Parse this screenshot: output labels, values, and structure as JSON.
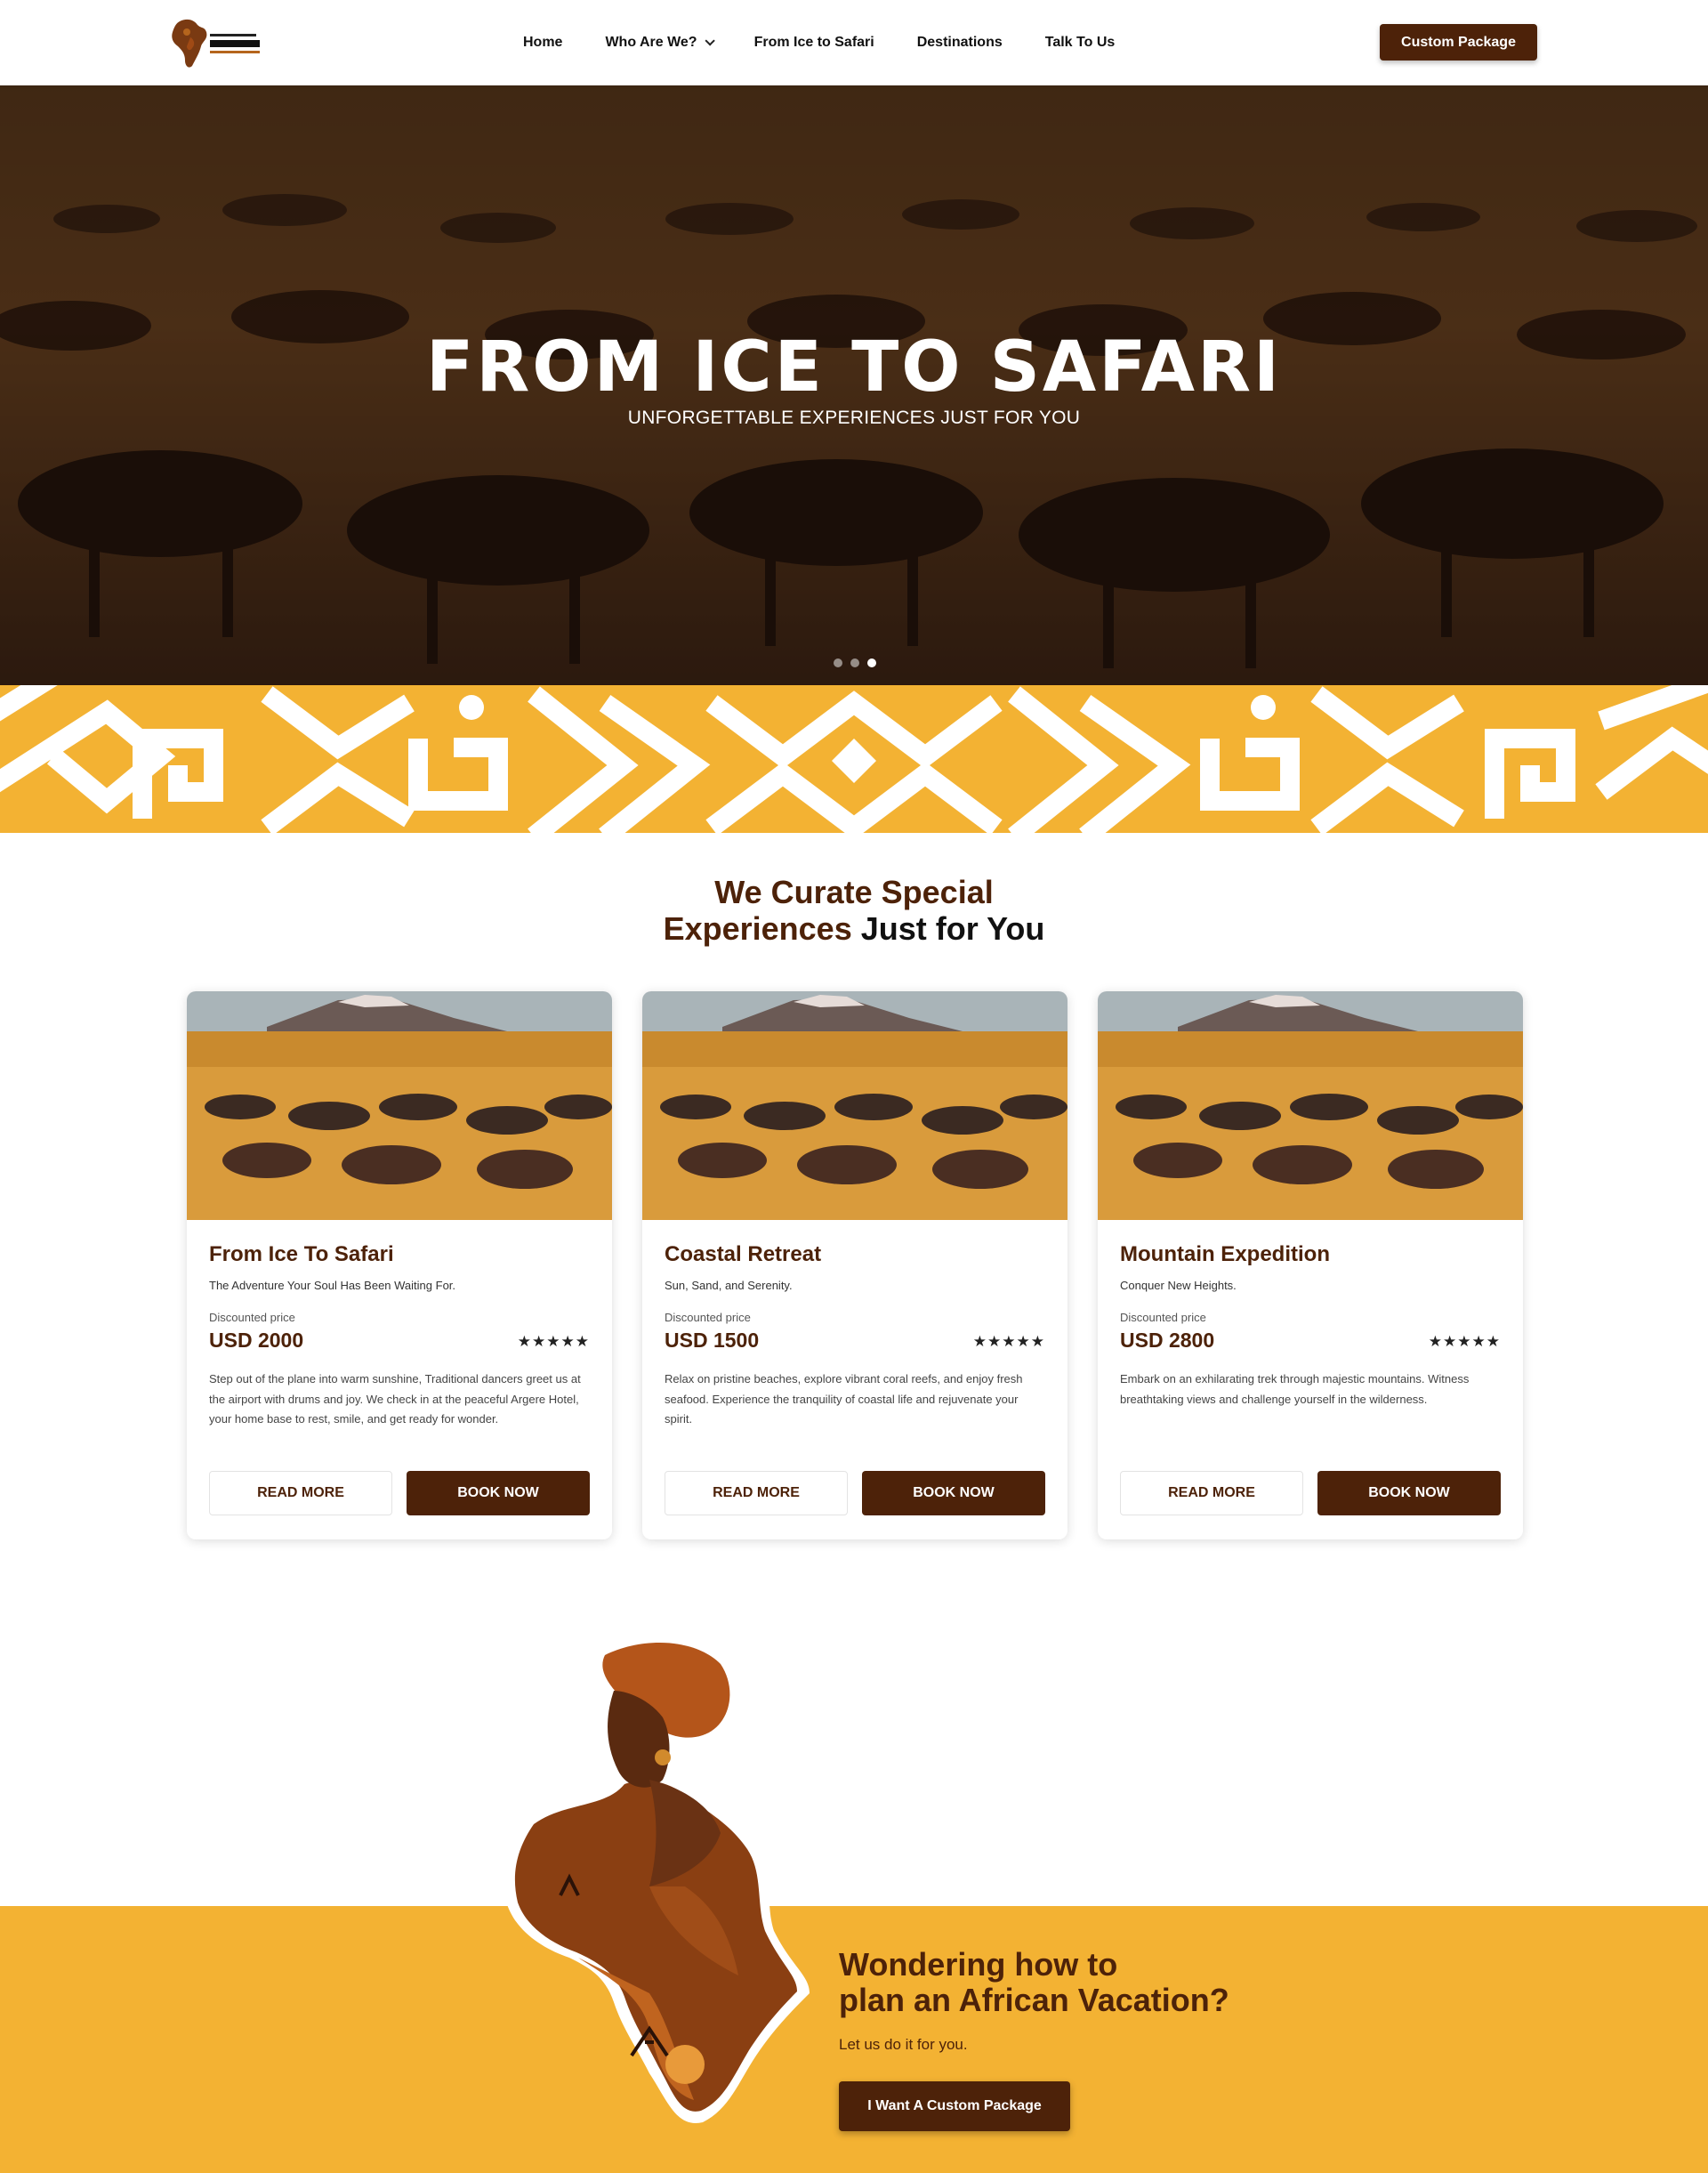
{
  "header": {
    "logo_icon": "africa-silhouette-logo",
    "nav": [
      {
        "label": "Home"
      },
      {
        "label": "Who Are We?"
      },
      {
        "label": "From Ice to Safari"
      },
      {
        "label": "Destinations"
      },
      {
        "label": "Talk To Us"
      }
    ],
    "cta_label": "Custom Package"
  },
  "hero": {
    "title": "FROM ICE TO SAFARI",
    "subtitle": "UNFORGETTABLE EXPERIENCES JUST FOR YOU",
    "slides_count": 3,
    "active_slide": 3
  },
  "section": {
    "title_line1": "We Curate Special",
    "title_line2_accent": "Experiences",
    "title_line2_dark": " Just for You"
  },
  "cards": [
    {
      "title": "From Ice To Safari",
      "tagline": "The Adventure Your Soul Has Been Waiting For.",
      "price_label": "Discounted price",
      "price": "USD 2000",
      "stars": "★★★★★",
      "description": "Step out of the plane into warm sunshine, Traditional dancers greet us at the airport with drums and joy. We check in at the peaceful Argere Hotel, your home base to rest, smile, and get ready for wonder.",
      "read_more": "READ MORE",
      "book_now": "BOOK NOW"
    },
    {
      "title": "Coastal Retreat",
      "tagline": "Sun, Sand, and Serenity.",
      "price_label": "Discounted price",
      "price": "USD 1500",
      "stars": "★★★★★",
      "description": "Relax on pristine beaches, explore vibrant coral reefs, and enjoy fresh seafood. Experience the tranquility of coastal life and rejuvenate your spirit.",
      "read_more": "READ MORE",
      "book_now": "BOOK NOW"
    },
    {
      "title": "Mountain Expedition",
      "tagline": "Conquer New Heights.",
      "price_label": "Discounted price",
      "price": "USD 2800",
      "stars": "★★★★★",
      "description": "Embark on an exhilarating trek through majestic mountains. Witness breathtaking views and challenge yourself in the wilderness.",
      "read_more": "READ MORE",
      "book_now": "BOOK NOW"
    }
  ],
  "cta": {
    "title_line1": "Wondering how to",
    "title_line2": "plan an African Vacation?",
    "subtitle": "Let us do it for you.",
    "button": "I Want A Custom Package"
  },
  "colors": {
    "brand_brown": "#4d2209",
    "accent_gold": "#f3b233"
  }
}
